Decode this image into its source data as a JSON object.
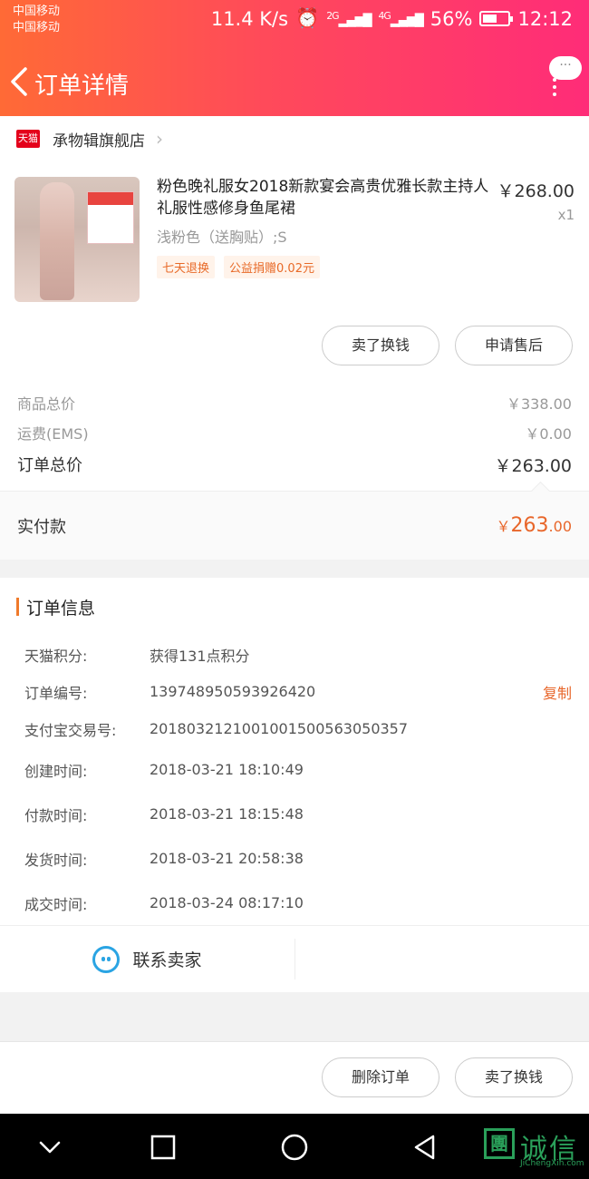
{
  "status_bar": {
    "carrier1": "中国移动",
    "carrier2": "中国移动",
    "speed": "11.4 K/s",
    "net1": "2G",
    "net2": "4G",
    "battery": "56%",
    "time": "12:12"
  },
  "header": {
    "title": "订单详情",
    "more_bubble": "···"
  },
  "shop": {
    "name": "承物辑旗舰店",
    "badge": "天猫"
  },
  "product": {
    "title": "粉色晚礼服女2018新款宴会高贵优雅长款主持人礼服性感修身鱼尾裙",
    "spec": "浅粉色（送胸贴）;S",
    "price": "￥268.00",
    "qty": "x1",
    "tags": [
      "七天退换",
      "公益捐赠0.02元"
    ]
  },
  "item_buttons": {
    "sell": "卖了换钱",
    "after_sale": "申请售后"
  },
  "summary": {
    "goods_label": "商品总价",
    "goods_value": "￥338.00",
    "shipping_label": "运费(EMS)",
    "shipping_value": "￥0.00",
    "total_label": "订单总价",
    "total_value": "￥263.00"
  },
  "paid": {
    "label": "实付款",
    "symbol": "￥",
    "int": "263",
    "dec": ".00"
  },
  "order_info": {
    "title": "订单信息",
    "copy_label": "复制",
    "rows": [
      {
        "label": "天猫积分:",
        "value": "获得131点积分"
      },
      {
        "label": "订单编号:",
        "value": "139748950593926420"
      },
      {
        "label": "支付宝交易号:",
        "value": "2018032121001001500563050357"
      },
      {
        "label": "创建时间:",
        "value": "2018-03-21 18:10:49"
      },
      {
        "label": "付款时间:",
        "value": "2018-03-21 18:15:48"
      },
      {
        "label": "发货时间:",
        "value": "2018-03-21 20:58:38"
      },
      {
        "label": "成交时间:",
        "value": "2018-03-24 08:17:10"
      }
    ]
  },
  "contact": {
    "label": "联系卖家"
  },
  "bottom": {
    "delete": "删除订单",
    "sell": "卖了换钱"
  },
  "watermark": {
    "box": "團",
    "text": "诚信",
    "sub": "JiChengXin.com"
  }
}
